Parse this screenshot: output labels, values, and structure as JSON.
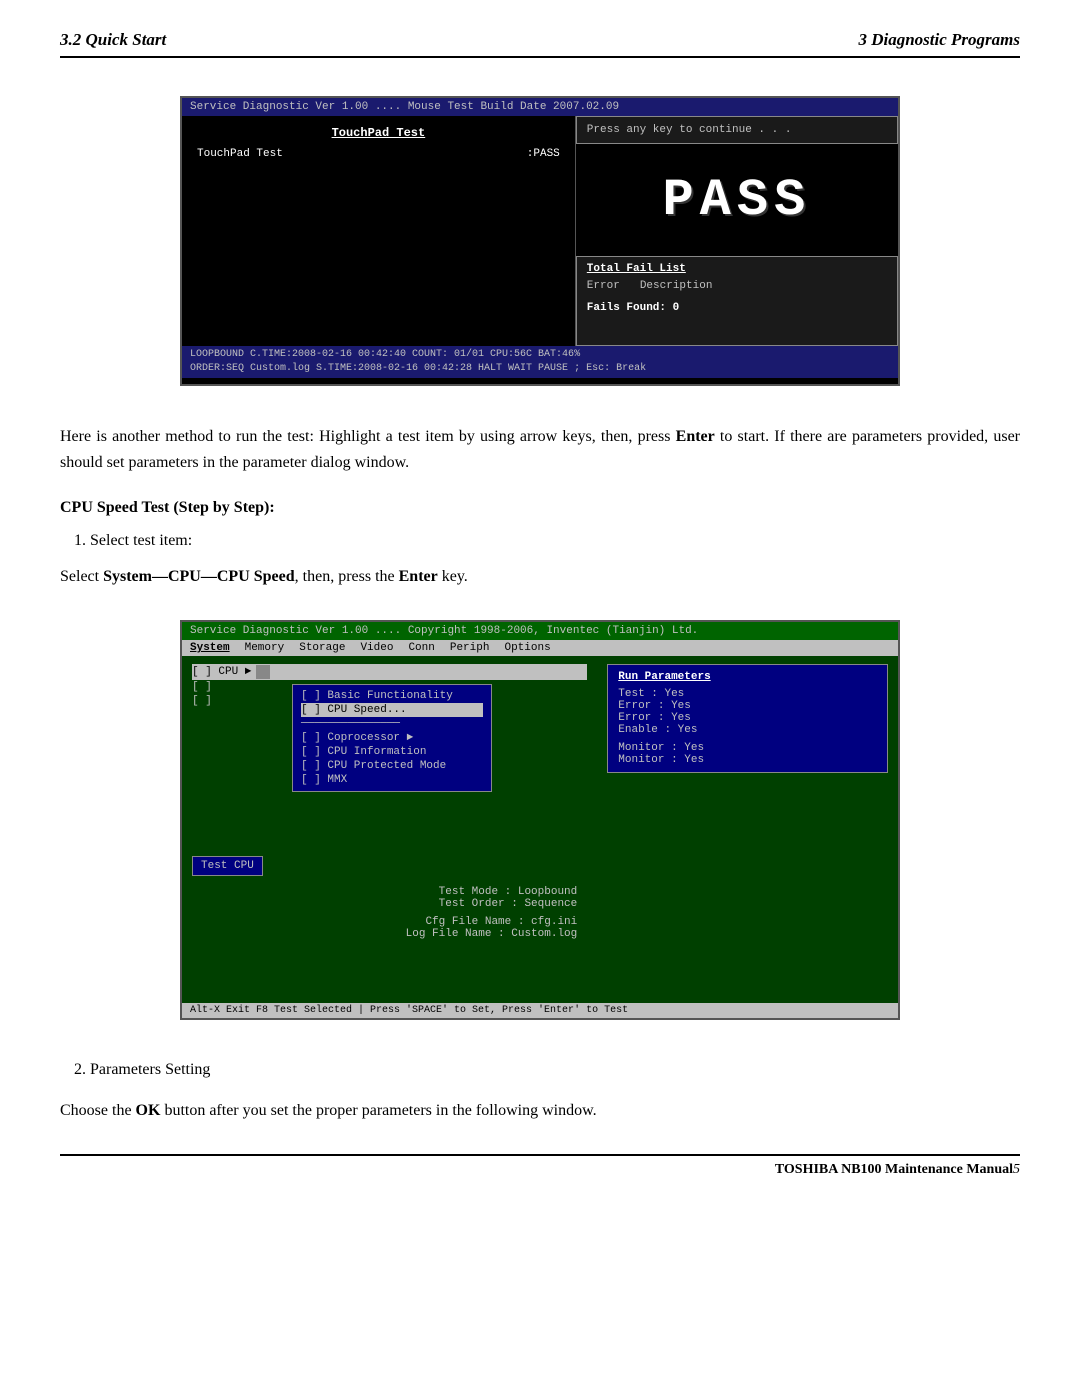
{
  "header": {
    "left": "3.2 Quick Start",
    "right": "3  Diagnostic Programs"
  },
  "screenshot1": {
    "top_bar": "Service Diagnostic Ver 1.00 .... Mouse Test Build Date 2007.02.09",
    "touchpad_title": "TouchPad Test",
    "touchpad_label": "TouchPad Test",
    "touchpad_status": ":PASS",
    "press_continue": "Press any key to continue . . .",
    "pass_text": "PASS",
    "fail_list_title": "Total Fail List",
    "error_col": "Error",
    "desc_col": "Description",
    "fails_found": "Fails Found: 0",
    "bottom_line1": "LOOPBOUND         C.TIME:2008-02-16 00:42:40 COUNT: 01/01  CPU:56C BAT:46%",
    "bottom_line2": "ORDER:SEQ    Custom.log S.TIME:2008-02-16 00:42:28 HALT WAIT PAUSE ; Esc: Break"
  },
  "main_paragraph": "Here is another method to run the test: Highlight a test item by using arrow keys, then, press ",
  "main_enter": "Enter",
  "main_paragraph2": " to start. If there are parameters provided, user should set parameters in the parameter dialog window.",
  "section_heading": "CPU Speed Test (Step by Step):",
  "list_item1": "Select test item:",
  "select_instruction_prefix": "Select ",
  "select_bold": "System—CPU—CPU Speed",
  "select_suffix": ", then, press the ",
  "select_enter": "Enter",
  "select_key": " key.",
  "screenshot2": {
    "top_bar": "Service Diagnostic Ver 1.00 .... Copyright 1998-2006, Inventec (Tianjin) Ltd.",
    "menu_items": [
      "System",
      "Memory",
      "Storage",
      "Video",
      "Conn",
      "Periph",
      "Options"
    ],
    "cpu_items": [
      "[ ] CPU  ►",
      "[ ]",
      "[ ]"
    ],
    "submenu_items": [
      "[ ] Basic Functionality",
      "[ ] CPU Speed...",
      "[ ] Coprocessor        ►",
      "[ ] CPU Information",
      "[ ] CPU Protected Mode",
      "[ ] MMX"
    ],
    "active_submenu": "[ ] CPU Speed...",
    "run_params_title": "Run Parameters",
    "run_params": [
      "Test : Yes",
      "Error : Yes",
      "Error : Yes",
      "Enable : Yes",
      "",
      "Monitor : Yes",
      "Monitor : Yes"
    ],
    "test_cpu_label": "Test CPU",
    "center_params": [
      "Test Mode : Loopbound",
      "Test Order : Sequence",
      "",
      "Cfg File Name : cfg.ini",
      "Log File Name : Custom.log"
    ],
    "bottom_bar": "Alt-X Exit   F8 Test Selected | Press 'SPACE' to Set, Press 'Enter' to Test"
  },
  "list_item2": "Parameters Setting",
  "bottom_paragraph_prefix": "Choose the ",
  "bottom_ok": "OK",
  "bottom_paragraph_suffix": " button after you set the proper parameters in the following window.",
  "footer": {
    "text": "TOSHIBA NB100 Maintenance Manual",
    "page": "5"
  }
}
